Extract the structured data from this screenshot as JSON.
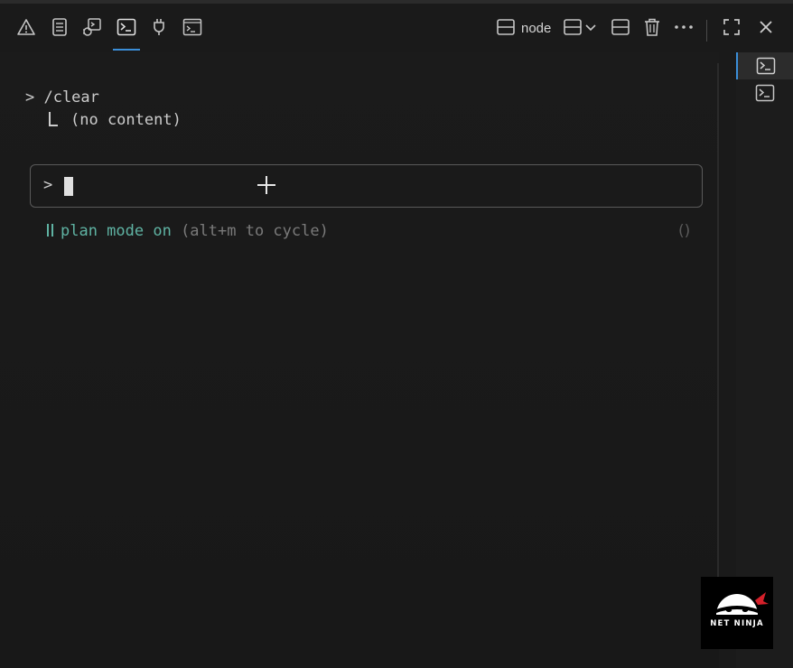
{
  "toolbar": {
    "tabs": [
      {
        "icon": "warning-icon",
        "label": "Problems"
      },
      {
        "icon": "output-icon",
        "label": "Output"
      },
      {
        "icon": "debug-console-icon",
        "label": "Debug Console"
      },
      {
        "icon": "terminal-icon",
        "label": "Terminal"
      },
      {
        "icon": "ports-icon",
        "label": "Ports"
      },
      {
        "icon": "terminal-panel-icon",
        "label": "Terminal Panel"
      }
    ],
    "active_tab": "Terminal",
    "terminal_name": "node",
    "actions": [
      "new-terminal-split-icon",
      "split-dropdown-icon",
      "split-terminal-icon",
      "trash-icon",
      "more-icon",
      "maximize-icon",
      "close-icon"
    ]
  },
  "terminal": {
    "command_line": "> /clear",
    "output_line": "(no content)",
    "input_prompt": ">",
    "status_mode": "plan mode on",
    "status_hint": " (alt+m to cycle)",
    "paren": "()"
  },
  "right_panel": {
    "items": [
      "terminal-instance-1",
      "terminal-instance-2"
    ]
  },
  "logo": {
    "text": "NET NINJA"
  },
  "colors": {
    "background": "#1a1a1a",
    "accent": "#3b8ed8",
    "mode_text": "#5fb3a3",
    "hint_text": "#7a7a7a"
  }
}
